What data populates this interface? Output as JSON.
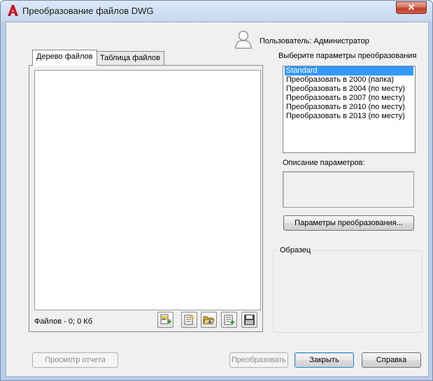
{
  "window": {
    "title": "Преобразование файлов DWG"
  },
  "user": {
    "label": "Пользователь: Администратор"
  },
  "tabs": [
    {
      "label": "Дерево файлов",
      "active": true
    },
    {
      "label": "Таблица файлов",
      "active": false
    }
  ],
  "files": {
    "count_label": "Файлов - 0; 0 Кб"
  },
  "toolbar": {
    "icons": [
      "add-file-icon",
      "new-list-icon",
      "open-list-icon",
      "append-list-icon",
      "save-list-icon"
    ]
  },
  "params": {
    "group_label": "Выберите параметры преобразования",
    "items": [
      "Standard",
      "Преобразовать в 2000 (папка)",
      "Преобразовать в 2004 (по месту)",
      "Преобразовать в 2007 (по месту)",
      "Преобразовать в 2010 (по месту)",
      "Преобразовать в 2013 (по месту)"
    ],
    "selected_index": 0,
    "description_label": "Описание параметров:",
    "setup_button": "Параметры преобразования..."
  },
  "sample": {
    "label": "Образец"
  },
  "buttons": {
    "view_report": "Просмотр отчета",
    "convert": "Преобразовать",
    "close": "Закрыть",
    "help": "Справка"
  },
  "colors": {
    "selection": "#3399ff",
    "close_button": "#c0402b",
    "app_icon": "#c8161d"
  }
}
